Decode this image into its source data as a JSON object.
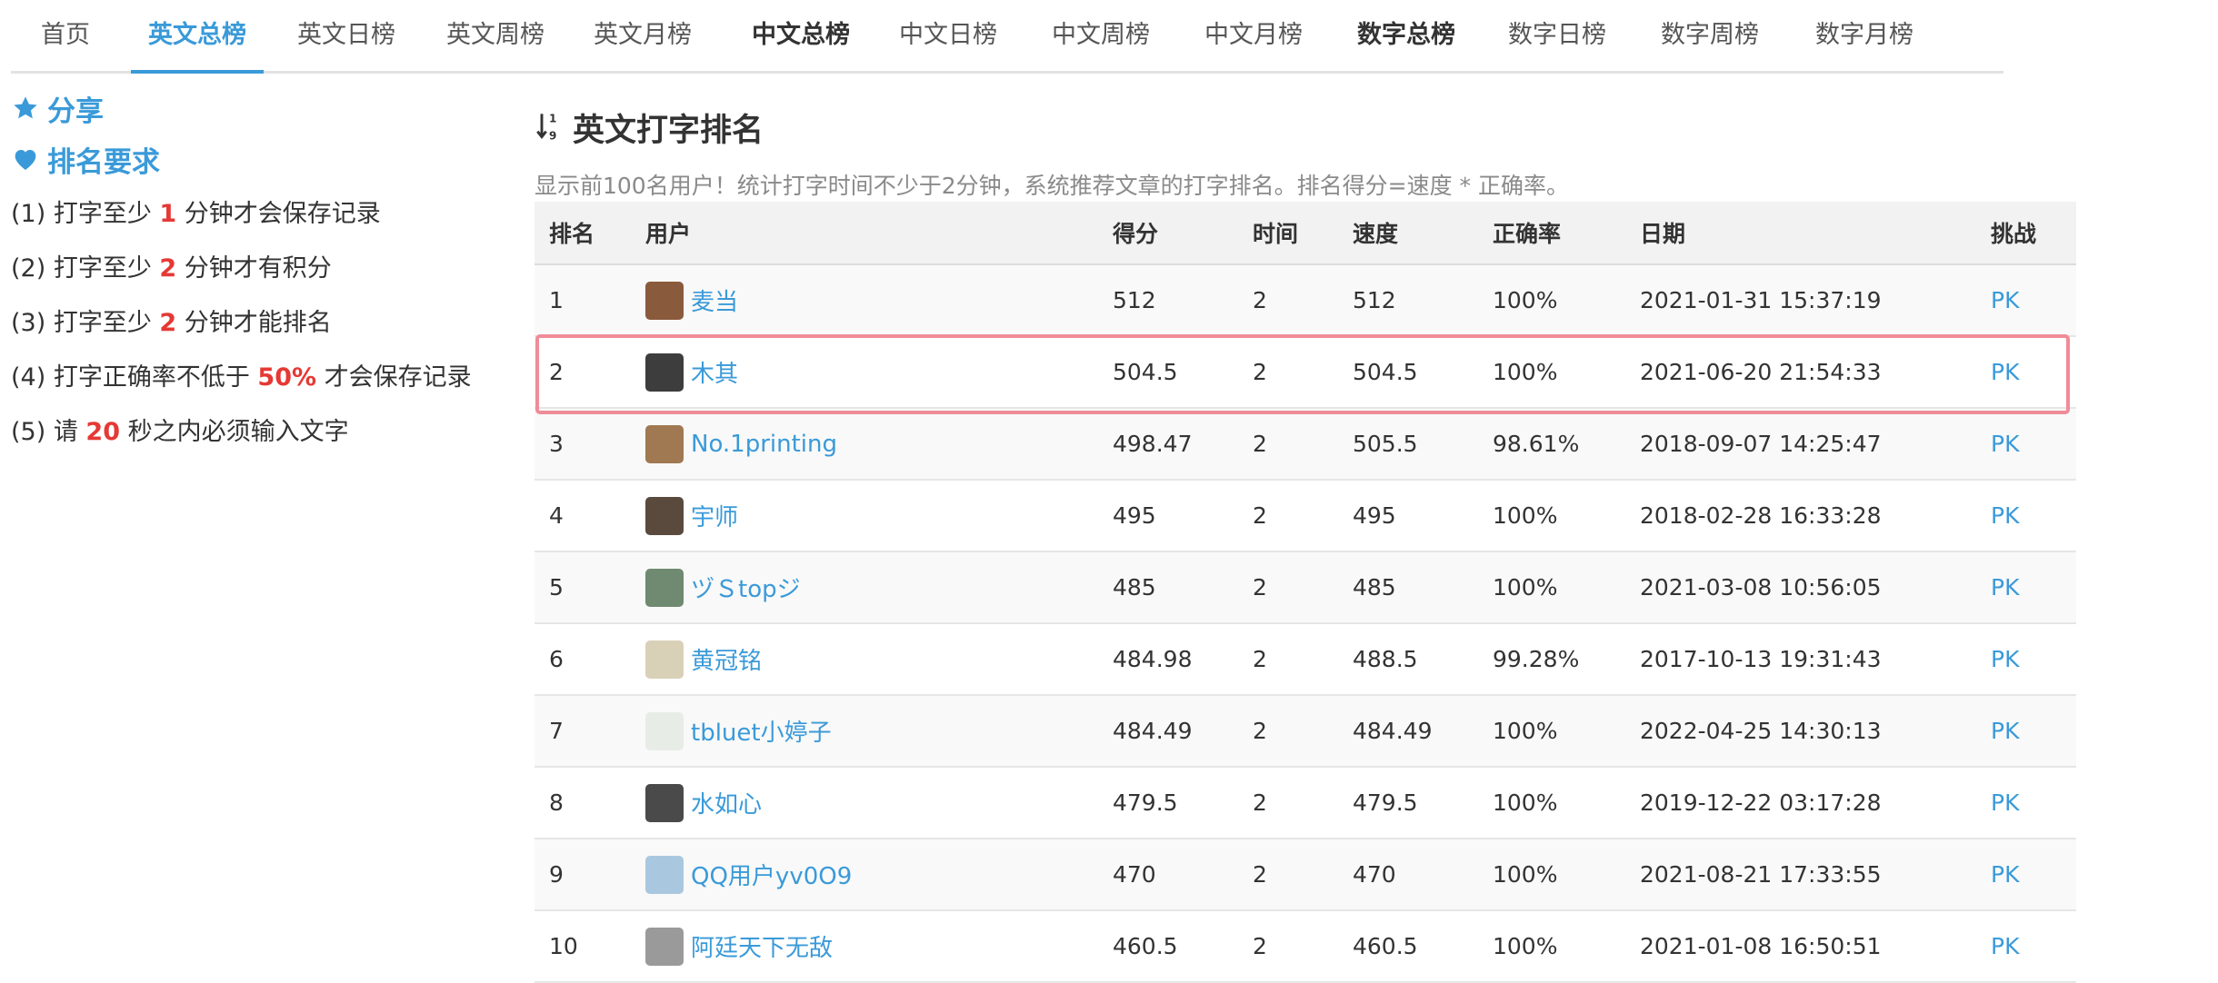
{
  "nav": {
    "tabs": [
      {
        "label": "首页",
        "active": false,
        "bold": false
      },
      {
        "label": "英文总榜",
        "active": true,
        "bold": true
      },
      {
        "label": "英文日榜",
        "active": false,
        "bold": false
      },
      {
        "label": "英文周榜",
        "active": false,
        "bold": false
      },
      {
        "label": "英文月榜",
        "active": false,
        "bold": false
      },
      {
        "label": "中文总榜",
        "active": false,
        "bold": true
      },
      {
        "label": "中文日榜",
        "active": false,
        "bold": false
      },
      {
        "label": "中文周榜",
        "active": false,
        "bold": false
      },
      {
        "label": "中文月榜",
        "active": false,
        "bold": false
      },
      {
        "label": "数字总榜",
        "active": false,
        "bold": true
      },
      {
        "label": "数字日榜",
        "active": false,
        "bold": false
      },
      {
        "label": "数字周榜",
        "active": false,
        "bold": false
      },
      {
        "label": "数字月榜",
        "active": false,
        "bold": false
      }
    ]
  },
  "sidebar": {
    "share_label": "分享",
    "rules_label": "排名要求",
    "rules": [
      {
        "prefix": "(1) 打字至少 ",
        "highlight": "1",
        "suffix": " 分钟才会保存记录"
      },
      {
        "prefix": "(2) 打字至少 ",
        "highlight": "2",
        "suffix": " 分钟才有积分"
      },
      {
        "prefix": "(3) 打字至少 ",
        "highlight": "2",
        "suffix": " 分钟才能排名"
      },
      {
        "prefix": "(4) 打字正确率不低于 ",
        "highlight": "50%",
        "suffix": " 才会保存记录"
      },
      {
        "prefix": "(5) 请 ",
        "highlight": "20",
        "suffix": " 秒之内必须输入文字"
      }
    ]
  },
  "main": {
    "title": "英文打字排名",
    "description": "显示前100名用户！统计打字时间不少于2分钟，系统推荐文章的打字排名。排名得分=速度 * 正确率。",
    "columns": [
      "排名",
      "用户",
      "得分",
      "时间",
      "速度",
      "正确率",
      "日期",
      "挑战"
    ],
    "highlighted_rank": "2",
    "rows": [
      {
        "rank": "1",
        "user": "麦当",
        "score": "512",
        "time": "2",
        "speed": "512",
        "accuracy": "100%",
        "date": "2021-01-31 15:37:19",
        "challenge": "PK",
        "avatar_color": "#8a5a3c"
      },
      {
        "rank": "2",
        "user": "木其",
        "score": "504.5",
        "time": "2",
        "speed": "504.5",
        "accuracy": "100%",
        "date": "2021-06-20 21:54:33",
        "challenge": "PK",
        "avatar_color": "#3d3d3d"
      },
      {
        "rank": "3",
        "user": "No.1printing",
        "score": "498.47",
        "time": "2",
        "speed": "505.5",
        "accuracy": "98.61%",
        "date": "2018-09-07 14:25:47",
        "challenge": "PK",
        "avatar_color": "#a07852"
      },
      {
        "rank": "4",
        "user": "宇师",
        "score": "495",
        "time": "2",
        "speed": "495",
        "accuracy": "100%",
        "date": "2018-02-28 16:33:28",
        "challenge": "PK",
        "avatar_color": "#5a4a3e"
      },
      {
        "rank": "5",
        "user": "ヅＳtopジ",
        "score": "485",
        "time": "2",
        "speed": "485",
        "accuracy": "100%",
        "date": "2021-03-08 10:56:05",
        "challenge": "PK",
        "avatar_color": "#6f8a70"
      },
      {
        "rank": "6",
        "user": "黄冠铭",
        "score": "484.98",
        "time": "2",
        "speed": "488.5",
        "accuracy": "99.28%",
        "date": "2017-10-13 19:31:43",
        "challenge": "PK",
        "avatar_color": "#d9d0b8"
      },
      {
        "rank": "7",
        "user": "tbluet小婷子",
        "score": "484.49",
        "time": "2",
        "speed": "484.49",
        "accuracy": "100%",
        "date": "2022-04-25 14:30:13",
        "challenge": "PK",
        "avatar_color": "#e8ece6"
      },
      {
        "rank": "8",
        "user": "水如心",
        "score": "479.5",
        "time": "2",
        "speed": "479.5",
        "accuracy": "100%",
        "date": "2019-12-22 03:17:28",
        "challenge": "PK",
        "avatar_color": "#4a4a4a"
      },
      {
        "rank": "9",
        "user": "QQ用户yv0O9",
        "score": "470",
        "time": "2",
        "speed": "470",
        "accuracy": "100%",
        "date": "2021-08-21 17:33:55",
        "challenge": "PK",
        "avatar_color": "#a9c8e0"
      },
      {
        "rank": "10",
        "user": "阿廷天下无敌",
        "score": "460.5",
        "time": "2",
        "speed": "460.5",
        "accuracy": "100%",
        "date": "2021-01-08 16:50:51",
        "challenge": "PK",
        "avatar_color": "#9a9a9a"
      }
    ]
  },
  "colors": {
    "accent": "#3a9ad9",
    "highlight_number": "#e53935",
    "selection_border": "#ef8c98"
  }
}
